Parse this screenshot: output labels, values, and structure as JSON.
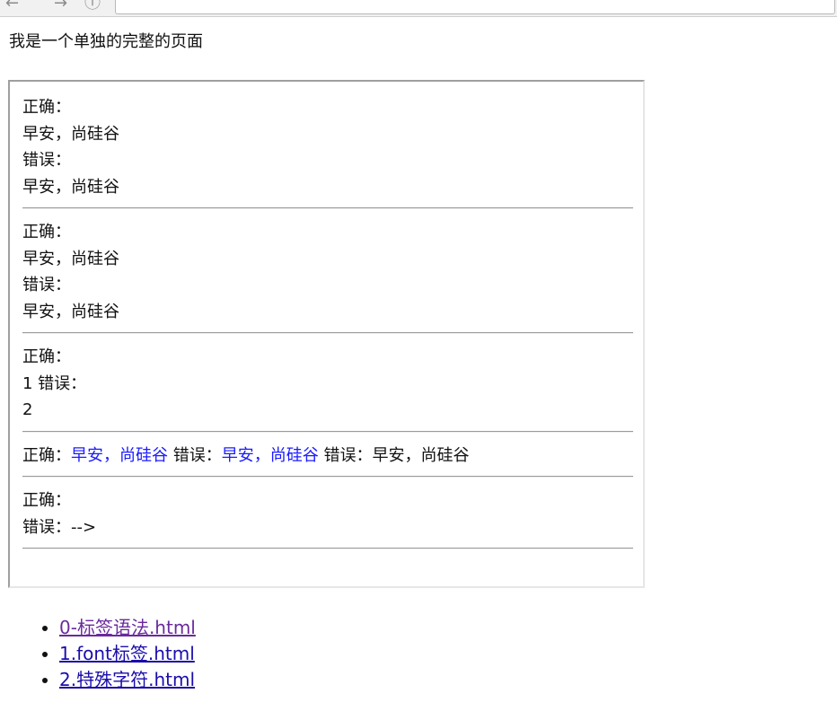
{
  "browser": {
    "nav_icons": [
      "back-icon",
      "forward-icon",
      "info-icon"
    ],
    "address_text": ""
  },
  "page": {
    "heading": "我是一个单独的完整的页面"
  },
  "frame": {
    "section1": {
      "line1": "正确：",
      "line2": "早安，尚硅谷",
      "line3": "错误：",
      "line4": "早安，尚硅谷"
    },
    "section2": {
      "line1": "正确：",
      "line2": "早安，尚硅谷",
      "line3": "错误：",
      "line4": "早安，尚硅谷"
    },
    "section3": {
      "line1": "正确：",
      "line2": "1 错误：",
      "line3": "2"
    },
    "section4": {
      "label_correct": "正确：",
      "blue_1": "早安，尚硅谷",
      "label_wrong_1": " 错误：",
      "blue_2": "早安，尚硅谷",
      "label_wrong_2": " 错误：",
      "plain_end": "早安，尚硅谷"
    },
    "section5": {
      "line1": "正确：",
      "line2": "错误：-->"
    }
  },
  "links": [
    {
      "label": "0-标签语法.html",
      "visited": true
    },
    {
      "label": "1.font标签.html",
      "visited": false
    },
    {
      "label": "2.特殊字符.html",
      "visited": false
    }
  ],
  "colors": {
    "link": "#1a0dab",
    "link_visited": "#6a2a9e",
    "blue_text": "#1a1aff"
  }
}
